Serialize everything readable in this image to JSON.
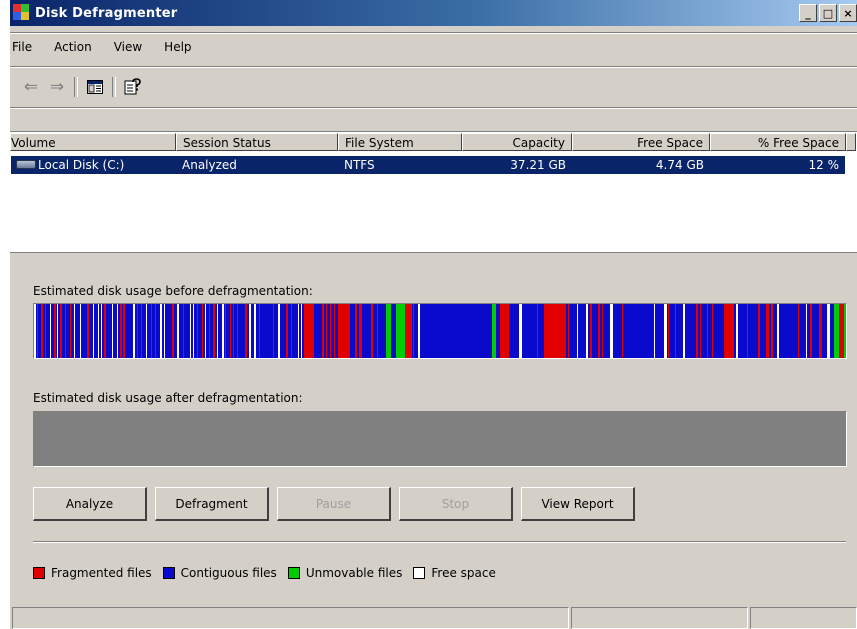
{
  "window": {
    "title": "Disk Defragmenter"
  },
  "title_buttons": {
    "minimize": "_",
    "maximize": "□",
    "close": "×"
  },
  "menu": [
    "File",
    "Action",
    "View",
    "Help"
  ],
  "toolbar": [
    {
      "icon": "back-arrow-icon",
      "glyph": "⇐",
      "enabled": false
    },
    {
      "icon": "forward-arrow-icon",
      "glyph": "⇒",
      "enabled": false
    },
    {
      "icon": "show-hide-console-tree-icon",
      "glyph": "",
      "enabled": true
    },
    {
      "icon": "help-icon",
      "glyph": "",
      "enabled": true
    }
  ],
  "volumes": {
    "columns": [
      "Volume",
      "Session Status",
      "File System",
      "Capacity",
      "Free Space",
      "% Free Space"
    ],
    "rows": [
      {
        "volume": "Local Disk (C:)",
        "session_status": "Analyzed",
        "file_system": "NTFS",
        "capacity": "37.21 GB",
        "free_space": "4.74 GB",
        "pct_free": "12 %",
        "selected": true
      }
    ]
  },
  "usage": {
    "before_label": "Estimated disk usage before defragmentation:",
    "after_label": "Estimated disk usage after defragmentation:"
  },
  "buttons": {
    "analyze": "Analyze",
    "defragment": "Defragment",
    "pause": "Pause",
    "stop": "Stop",
    "view_report": "View Report"
  },
  "legend": [
    {
      "label": "Fragmented files",
      "color": "#e00000"
    },
    {
      "label": "Contiguous files",
      "color": "#0a0acc"
    },
    {
      "label": "Unmovable files",
      "color": "#00cc00"
    },
    {
      "label": "Free space",
      "color": "#ffffff"
    }
  ],
  "colors": {
    "titlebar_start": "#0a246a",
    "titlebar_end": "#a6caf0",
    "selection": "#0a246a",
    "face": "#d4d0c8",
    "fragmented": "#e00000",
    "contiguous": "#0a0acc",
    "unmovable": "#00cc00",
    "free": "#ffffff"
  }
}
